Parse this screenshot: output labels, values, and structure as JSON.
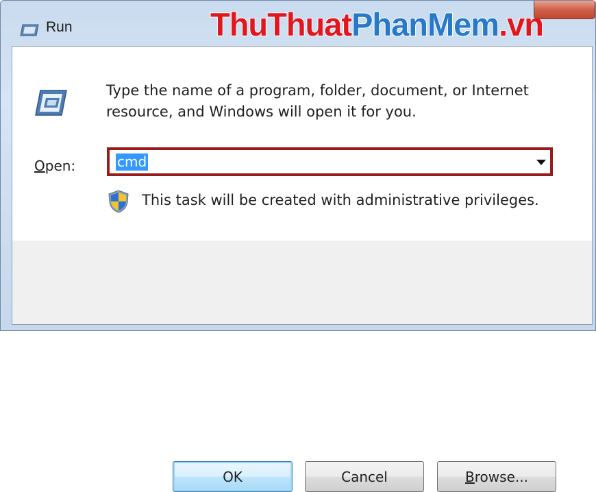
{
  "window": {
    "title": "Run",
    "watermark": {
      "part1": "ThuThuat",
      "part2": "PhanMem",
      "part3": ".vn"
    }
  },
  "description": "Type the name of a program, folder, document, or Internet resource, and Windows will open it for you.",
  "open": {
    "label_accel": "O",
    "label_rest": "pen:",
    "value": "cmd"
  },
  "admin_notice": "This task will be created with administrative privileges.",
  "buttons": {
    "ok": "OK",
    "cancel": "Cancel",
    "browse_accel": "B",
    "browse_rest": "rowse..."
  },
  "icons": {
    "title": "run-icon",
    "main": "run-icon",
    "shield": "uac-shield-icon",
    "dropdown": "chevron-down-icon",
    "close": "close-icon"
  },
  "colors": {
    "highlight_border": "#9b1b1b",
    "selection": "#3399ff",
    "watermark_red": "#e1171f",
    "watermark_blue": "#2879c9"
  }
}
